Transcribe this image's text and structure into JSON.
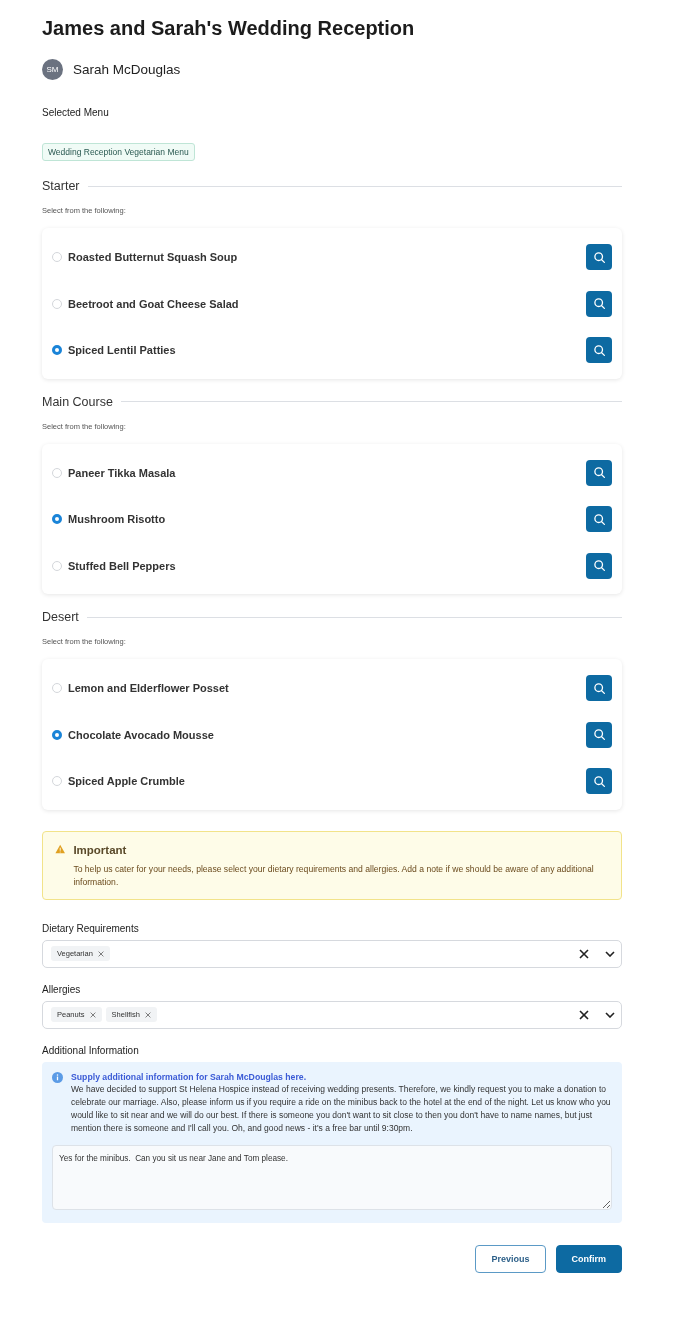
{
  "title": "James and Sarah's Wedding Reception",
  "guest": {
    "initials": "SM",
    "name": "Sarah McDouglas"
  },
  "selected_menu": {
    "label": "Selected Menu",
    "tag": "Wedding Reception Vegetarian Menu"
  },
  "courses": [
    {
      "title": "Starter",
      "hint": "Select from the following:",
      "options": [
        {
          "label": "Roasted Butternut Squash Soup",
          "selected": false
        },
        {
          "label": "Beetroot and Goat Cheese Salad",
          "selected": false
        },
        {
          "label": "Spiced Lentil Patties",
          "selected": true
        }
      ]
    },
    {
      "title": "Main Course",
      "hint": "Select from the following:",
      "options": [
        {
          "label": "Paneer Tikka Masala",
          "selected": false
        },
        {
          "label": "Mushroom Risotto",
          "selected": true
        },
        {
          "label": "Stuffed Bell Peppers",
          "selected": false
        }
      ]
    },
    {
      "title": "Desert",
      "hint": "Select from the following:",
      "options": [
        {
          "label": "Lemon and Elderflower Posset",
          "selected": false
        },
        {
          "label": "Chocolate Avocado Mousse",
          "selected": true
        },
        {
          "label": "Spiced Apple Crumble",
          "selected": false
        }
      ]
    }
  ],
  "notice": {
    "title": "Important",
    "text": "To help us cater for your needs, please select your dietary requirements and allergies. Add a note if we should be aware of any additional information."
  },
  "selects": [
    {
      "label": "Dietary Requirements",
      "chips": [
        "Vegetarian"
      ]
    },
    {
      "label": "Allergies",
      "chips": [
        "Peanuts",
        "Shellfish"
      ]
    }
  ],
  "additional": {
    "label": "Additional Information",
    "heading": "Supply additional information for Sarah McDouglas here.",
    "text": "We have decided to support St Helena Hospice instead of receiving wedding presents. Therefore, we kindly request you to make a donation to celebrate our marriage. Also, please inform us if you require a ride on the minibus back to the hotel at the end of the night. Let us know who you would like to sit near and we will do our best. If there is someone you don't want to sit close to then you don't have to name names, but just mention there is someone and I'll call you. Oh, and good news - it's a free bar until 9:30pm.",
    "value": "Yes for the minibus.  Can you sit us near Jane and Tom please."
  },
  "buttons": [
    {
      "label": "Previous",
      "kind": "secondary"
    },
    {
      "label": "Confirm",
      "kind": "primary"
    }
  ]
}
